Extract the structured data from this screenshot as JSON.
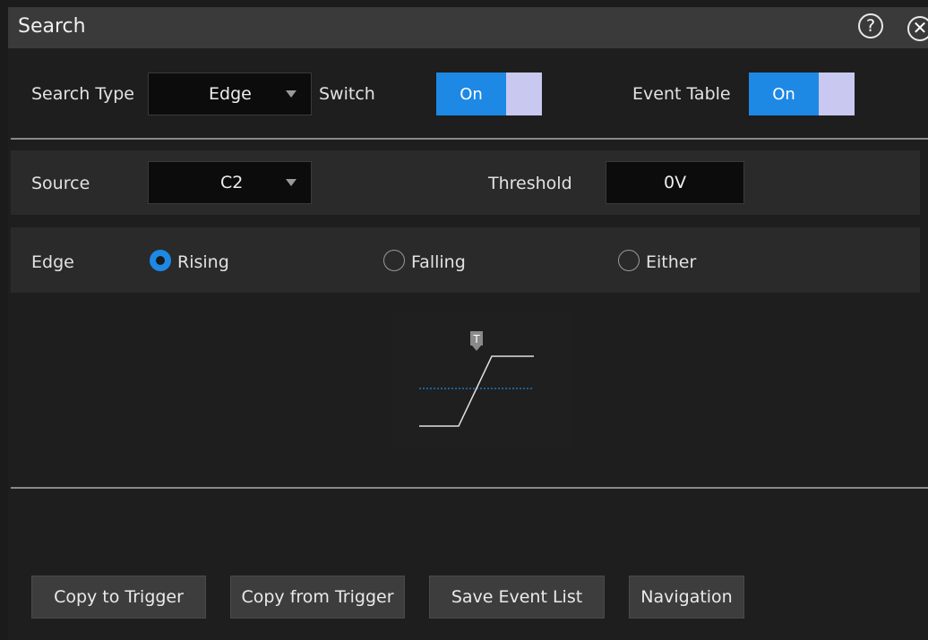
{
  "window": {
    "title": "Search"
  },
  "search_type": {
    "label": "Search Type",
    "value": "Edge"
  },
  "switch": {
    "label": "Switch",
    "state": "On"
  },
  "event_table": {
    "label": "Event Table",
    "state": "On"
  },
  "source": {
    "label": "Source",
    "value": "C2"
  },
  "threshold": {
    "label": "Threshold",
    "value": "0V"
  },
  "edge": {
    "label": "Edge",
    "options": [
      "Rising",
      "Falling",
      "Either"
    ],
    "selected": "Rising"
  },
  "diagram": {
    "trigger_marker": "T"
  },
  "buttons": {
    "copy_to_trigger": "Copy to Trigger",
    "copy_from_trigger": "Copy from Trigger",
    "save_event_list": "Save Event List",
    "navigation": "Navigation"
  },
  "colors": {
    "accent": "#1e88e5",
    "toggle_knob": "#c8c8f0",
    "threshold_line": "#1e88e5"
  }
}
